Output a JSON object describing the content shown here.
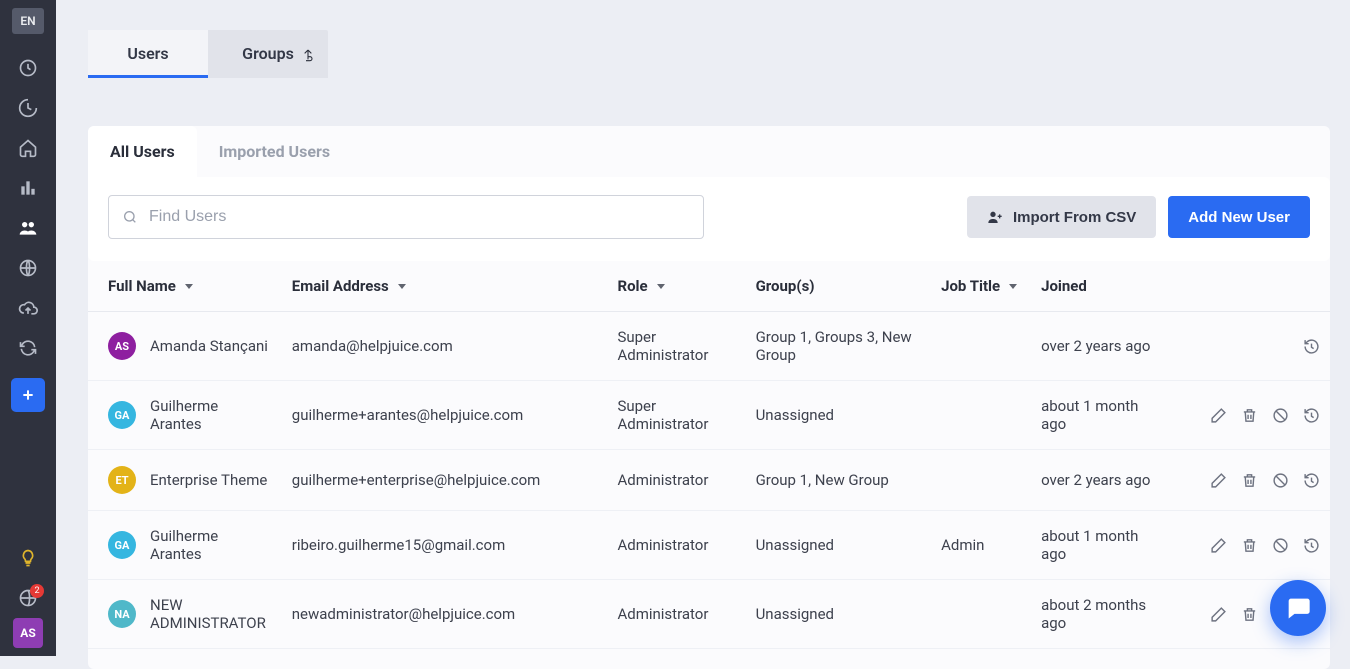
{
  "sidebar": {
    "lang_badge": "EN",
    "notif_count": "2",
    "bottom_avatar": {
      "initials": "AS",
      "bg": "#8e3db3"
    }
  },
  "top_tabs": {
    "users": "Users",
    "groups": "Groups"
  },
  "sub_tabs": {
    "all_users": "All Users",
    "imported_users": "Imported Users"
  },
  "toolbar": {
    "search_placeholder": "Find Users",
    "import_label": "Import From CSV",
    "add_label": "Add New User"
  },
  "columns": {
    "full_name": "Full Name",
    "email": "Email Address",
    "role": "Role",
    "groups": "Group(s)",
    "job_title": "Job Title",
    "joined": "Joined"
  },
  "rows": [
    {
      "initials": "AS",
      "avatar_bg": "#8e1fa0",
      "name": "Amanda Stançani",
      "email": "amanda@helpjuice.com",
      "role": "Super Administrator",
      "groups": "Group 1, Groups 3, New Group",
      "job_title": "",
      "joined": "over 2 years ago",
      "actions": [
        "history"
      ]
    },
    {
      "initials": "GA",
      "avatar_bg": "#35b6e0",
      "name": "Guilherme Arantes",
      "email": "guilherme+arantes@helpjuice.com",
      "role": "Super Administrator",
      "groups": "Unassigned",
      "job_title": "",
      "joined": "about 1 month ago",
      "actions": [
        "edit",
        "delete",
        "ban",
        "history"
      ]
    },
    {
      "initials": "ET",
      "avatar_bg": "#e3b318",
      "name": "Enterprise Theme",
      "email": "guilherme+enterprise@helpjuice.com",
      "role": "Administrator",
      "groups": "Group 1, New Group",
      "job_title": "",
      "joined": "over 2 years ago",
      "actions": [
        "edit",
        "delete",
        "ban",
        "history"
      ]
    },
    {
      "initials": "GA",
      "avatar_bg": "#35b6e0",
      "name": "Guilherme Arantes",
      "email": "ribeiro.guilherme15@gmail.com",
      "role": "Administrator",
      "groups": "Unassigned",
      "job_title": "Admin",
      "joined": "about 1 month ago",
      "actions": [
        "edit",
        "delete",
        "ban",
        "history"
      ]
    },
    {
      "initials": "NA",
      "avatar_bg": "#4fb8c9",
      "name": "NEW ADMINISTRATOR",
      "email": "newadministrator@helpjuice.com",
      "role": "Administrator",
      "groups": "Unassigned",
      "job_title": "",
      "joined": "about 2 months ago",
      "actions": [
        "edit",
        "delete",
        "ban",
        "history"
      ]
    }
  ]
}
